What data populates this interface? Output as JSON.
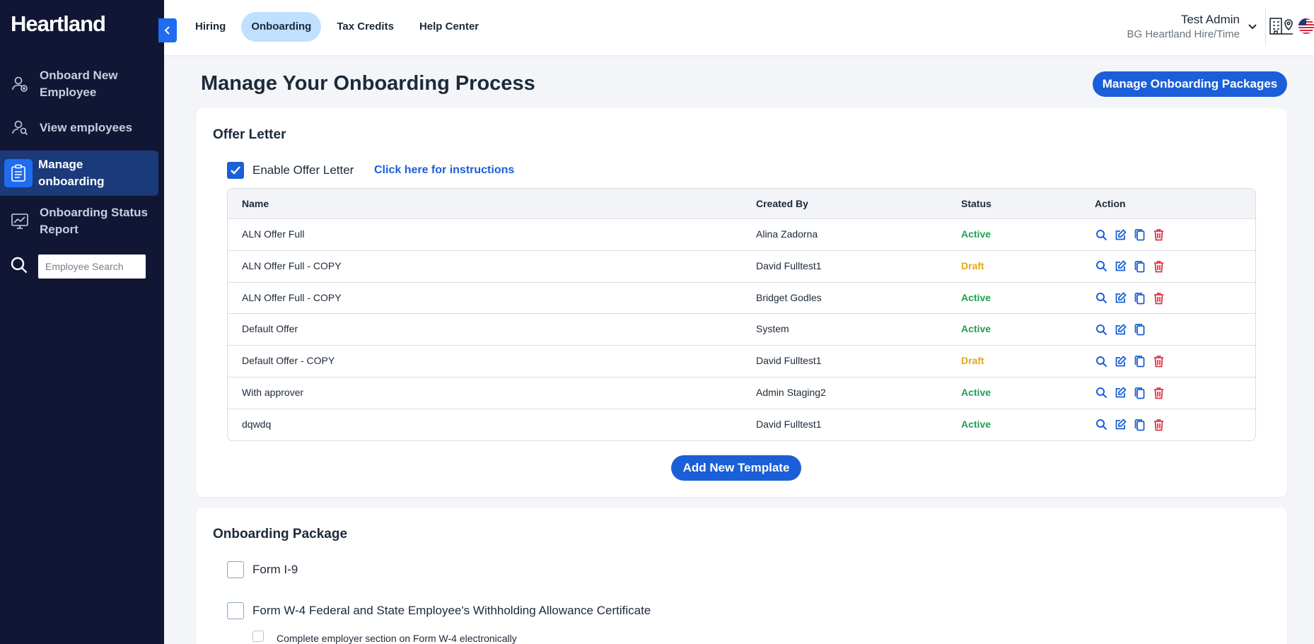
{
  "app": {
    "logo": "Heartland"
  },
  "sidebar": {
    "items": [
      {
        "label": "Onboard New Employee",
        "icon": "user-plus-icon"
      },
      {
        "label": "View employees",
        "icon": "users-icon"
      },
      {
        "label": "Manage onboarding",
        "icon": "clipboard-icon",
        "active": true
      },
      {
        "label": "Onboarding Status Report",
        "icon": "chart-icon"
      }
    ],
    "search": {
      "placeholder": "Employee Search"
    }
  },
  "topbar": {
    "tabs": [
      {
        "label": "Hiring"
      },
      {
        "label": "Onboarding",
        "active": true
      },
      {
        "label": "Tax Credits"
      },
      {
        "label": "Help Center"
      }
    ],
    "user": {
      "name": "Test Admin",
      "org": "BG Heartland Hire/Time"
    }
  },
  "main": {
    "title": "Manage Your Onboarding Process",
    "packages_button": "Manage Onboarding Packages",
    "offer_letter": {
      "title": "Offer Letter",
      "enable_label": "Enable Offer Letter",
      "instructions_link": "Click here for instructions",
      "columns": [
        "Name",
        "Created By",
        "Status",
        "Action"
      ],
      "rows": [
        {
          "name": "ALN Offer Full",
          "created_by": "Alina Zadorna",
          "status": "Active",
          "deletable": true
        },
        {
          "name": "ALN Offer Full - COPY",
          "created_by": "David Fulltest1",
          "status": "Draft",
          "deletable": true
        },
        {
          "name": "ALN Offer Full - COPY",
          "created_by": "Bridget Godles",
          "status": "Active",
          "deletable": true
        },
        {
          "name": "Default Offer",
          "created_by": "System",
          "status": "Active",
          "deletable": false
        },
        {
          "name": "Default Offer - COPY",
          "created_by": "David Fulltest1",
          "status": "Draft",
          "deletable": true
        },
        {
          "name": "With approver",
          "created_by": "Admin Staging2",
          "status": "Active",
          "deletable": true
        },
        {
          "name": "dqwdq",
          "created_by": "David Fulltest1",
          "status": "Active",
          "deletable": true
        }
      ],
      "add_button": "Add New Template"
    },
    "package": {
      "title": "Onboarding Package",
      "form_i9": "Form I-9",
      "form_w4": "Form W-4 Federal and State Employee's Withholding Allowance Certificate",
      "w4_sub": "Complete employer section on Form W-4 electronically"
    }
  },
  "colors": {
    "sidebar_bg": "#111634",
    "accent": "#1a5fd8",
    "active_status": "#21a152",
    "draft_status": "#e8a712",
    "danger": "#e0344a"
  }
}
